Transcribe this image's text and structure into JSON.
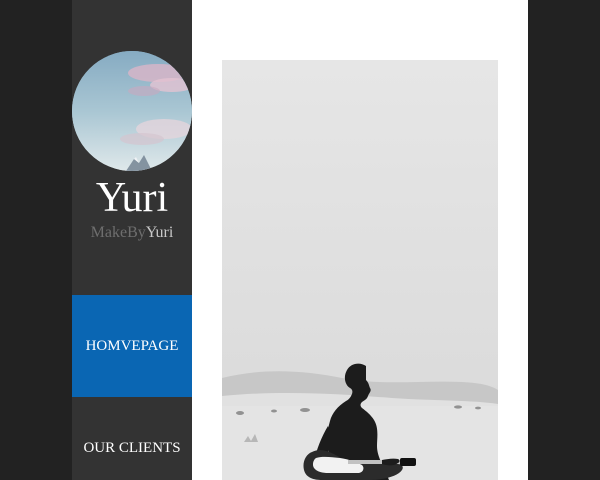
{
  "brand": {
    "name": "Yuri",
    "subtitle_prefix": "MakeBy",
    "subtitle_suffix": "Yuri"
  },
  "nav": {
    "items": [
      {
        "label": "HOMVEPAGE",
        "active": true
      },
      {
        "label": "OUR CLIENTS",
        "active": false
      }
    ]
  },
  "colors": {
    "background": "#222222",
    "sidebar": "#333333",
    "active_nav": "#0a66b3",
    "content": "#ffffff"
  },
  "media": {
    "avatar": "sky-clouds-mountain-image",
    "hero": "guitarist-silhouette-desert-image"
  }
}
